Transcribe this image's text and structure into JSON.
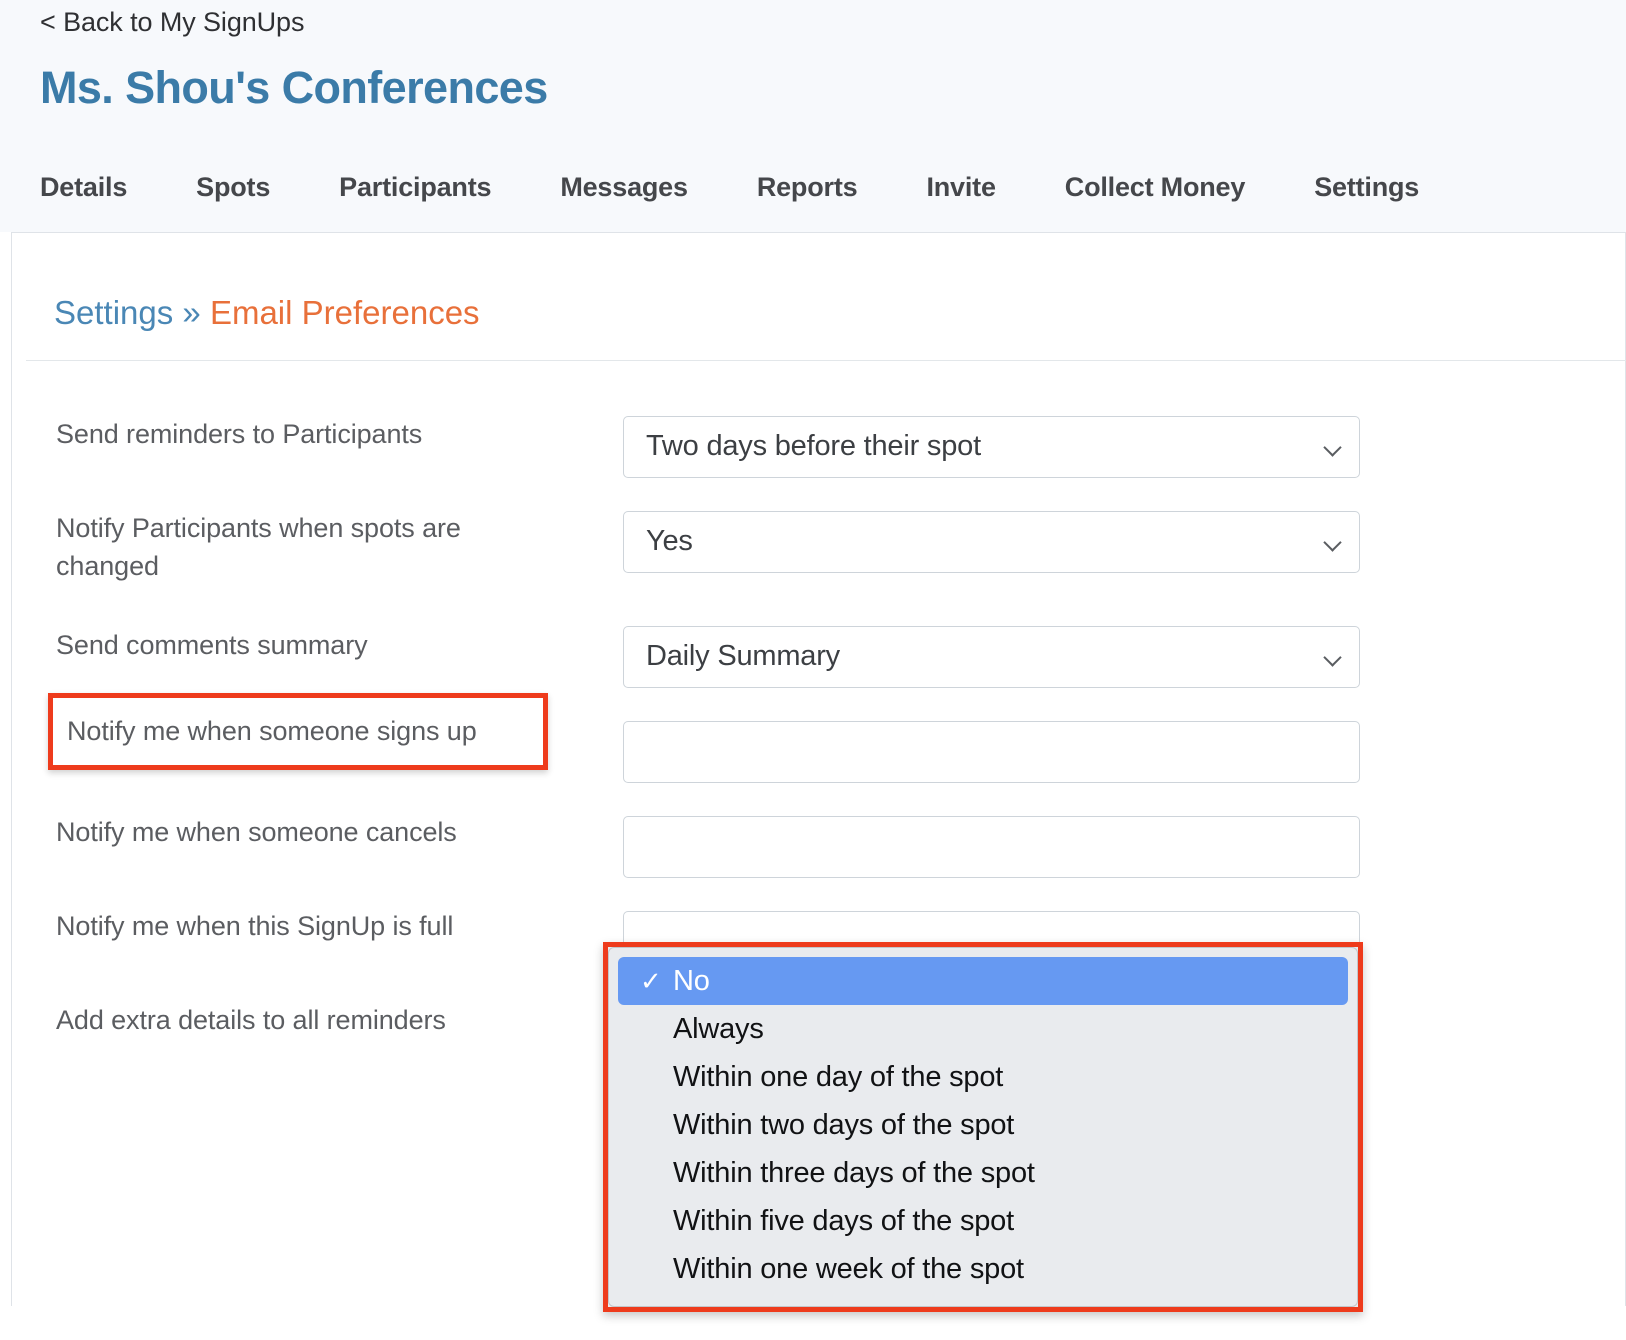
{
  "header": {
    "back_link": "< Back to My SignUps",
    "title": "Ms. Shou's Conferences",
    "tabs": [
      {
        "label": "Details"
      },
      {
        "label": "Spots"
      },
      {
        "label": "Participants"
      },
      {
        "label": "Messages"
      },
      {
        "label": "Reports"
      },
      {
        "label": "Invite"
      },
      {
        "label": "Collect Money"
      },
      {
        "label": "Settings"
      }
    ]
  },
  "breadcrumb": {
    "parent": "Settings",
    "separator": "»",
    "current": "Email Preferences"
  },
  "form": {
    "rows": [
      {
        "label": "Send reminders to Participants",
        "value": "Two days before their spot"
      },
      {
        "label": "Notify Participants when spots are changed",
        "value": "Yes"
      },
      {
        "label": "Send comments summary",
        "value": "Daily Summary"
      },
      {
        "label": "Notify me when someone signs up",
        "value": "No"
      },
      {
        "label": "Notify me when someone cancels",
        "value": ""
      },
      {
        "label": "Notify me when this SignUp is full",
        "value": ""
      },
      {
        "label": "Add extra details to all reminders",
        "value": ""
      }
    ]
  },
  "dropdown": {
    "open_for": "Notify me when someone signs up",
    "selected_index": 0,
    "check_glyph": "✓",
    "options": [
      {
        "label": "No"
      },
      {
        "label": "Always"
      },
      {
        "label": "Within one day of the spot"
      },
      {
        "label": "Within two days of the spot"
      },
      {
        "label": "Within three days of the spot"
      },
      {
        "label": "Within five days of the spot"
      },
      {
        "label": "Within one week of the spot"
      }
    ]
  },
  "colors": {
    "brand_blue": "#3b7ba8",
    "breadcrumb_orange": "#e8703a",
    "highlight_red": "#ee3b1c",
    "selection_blue": "#6699f2",
    "header_bg": "#f7f9fc"
  }
}
